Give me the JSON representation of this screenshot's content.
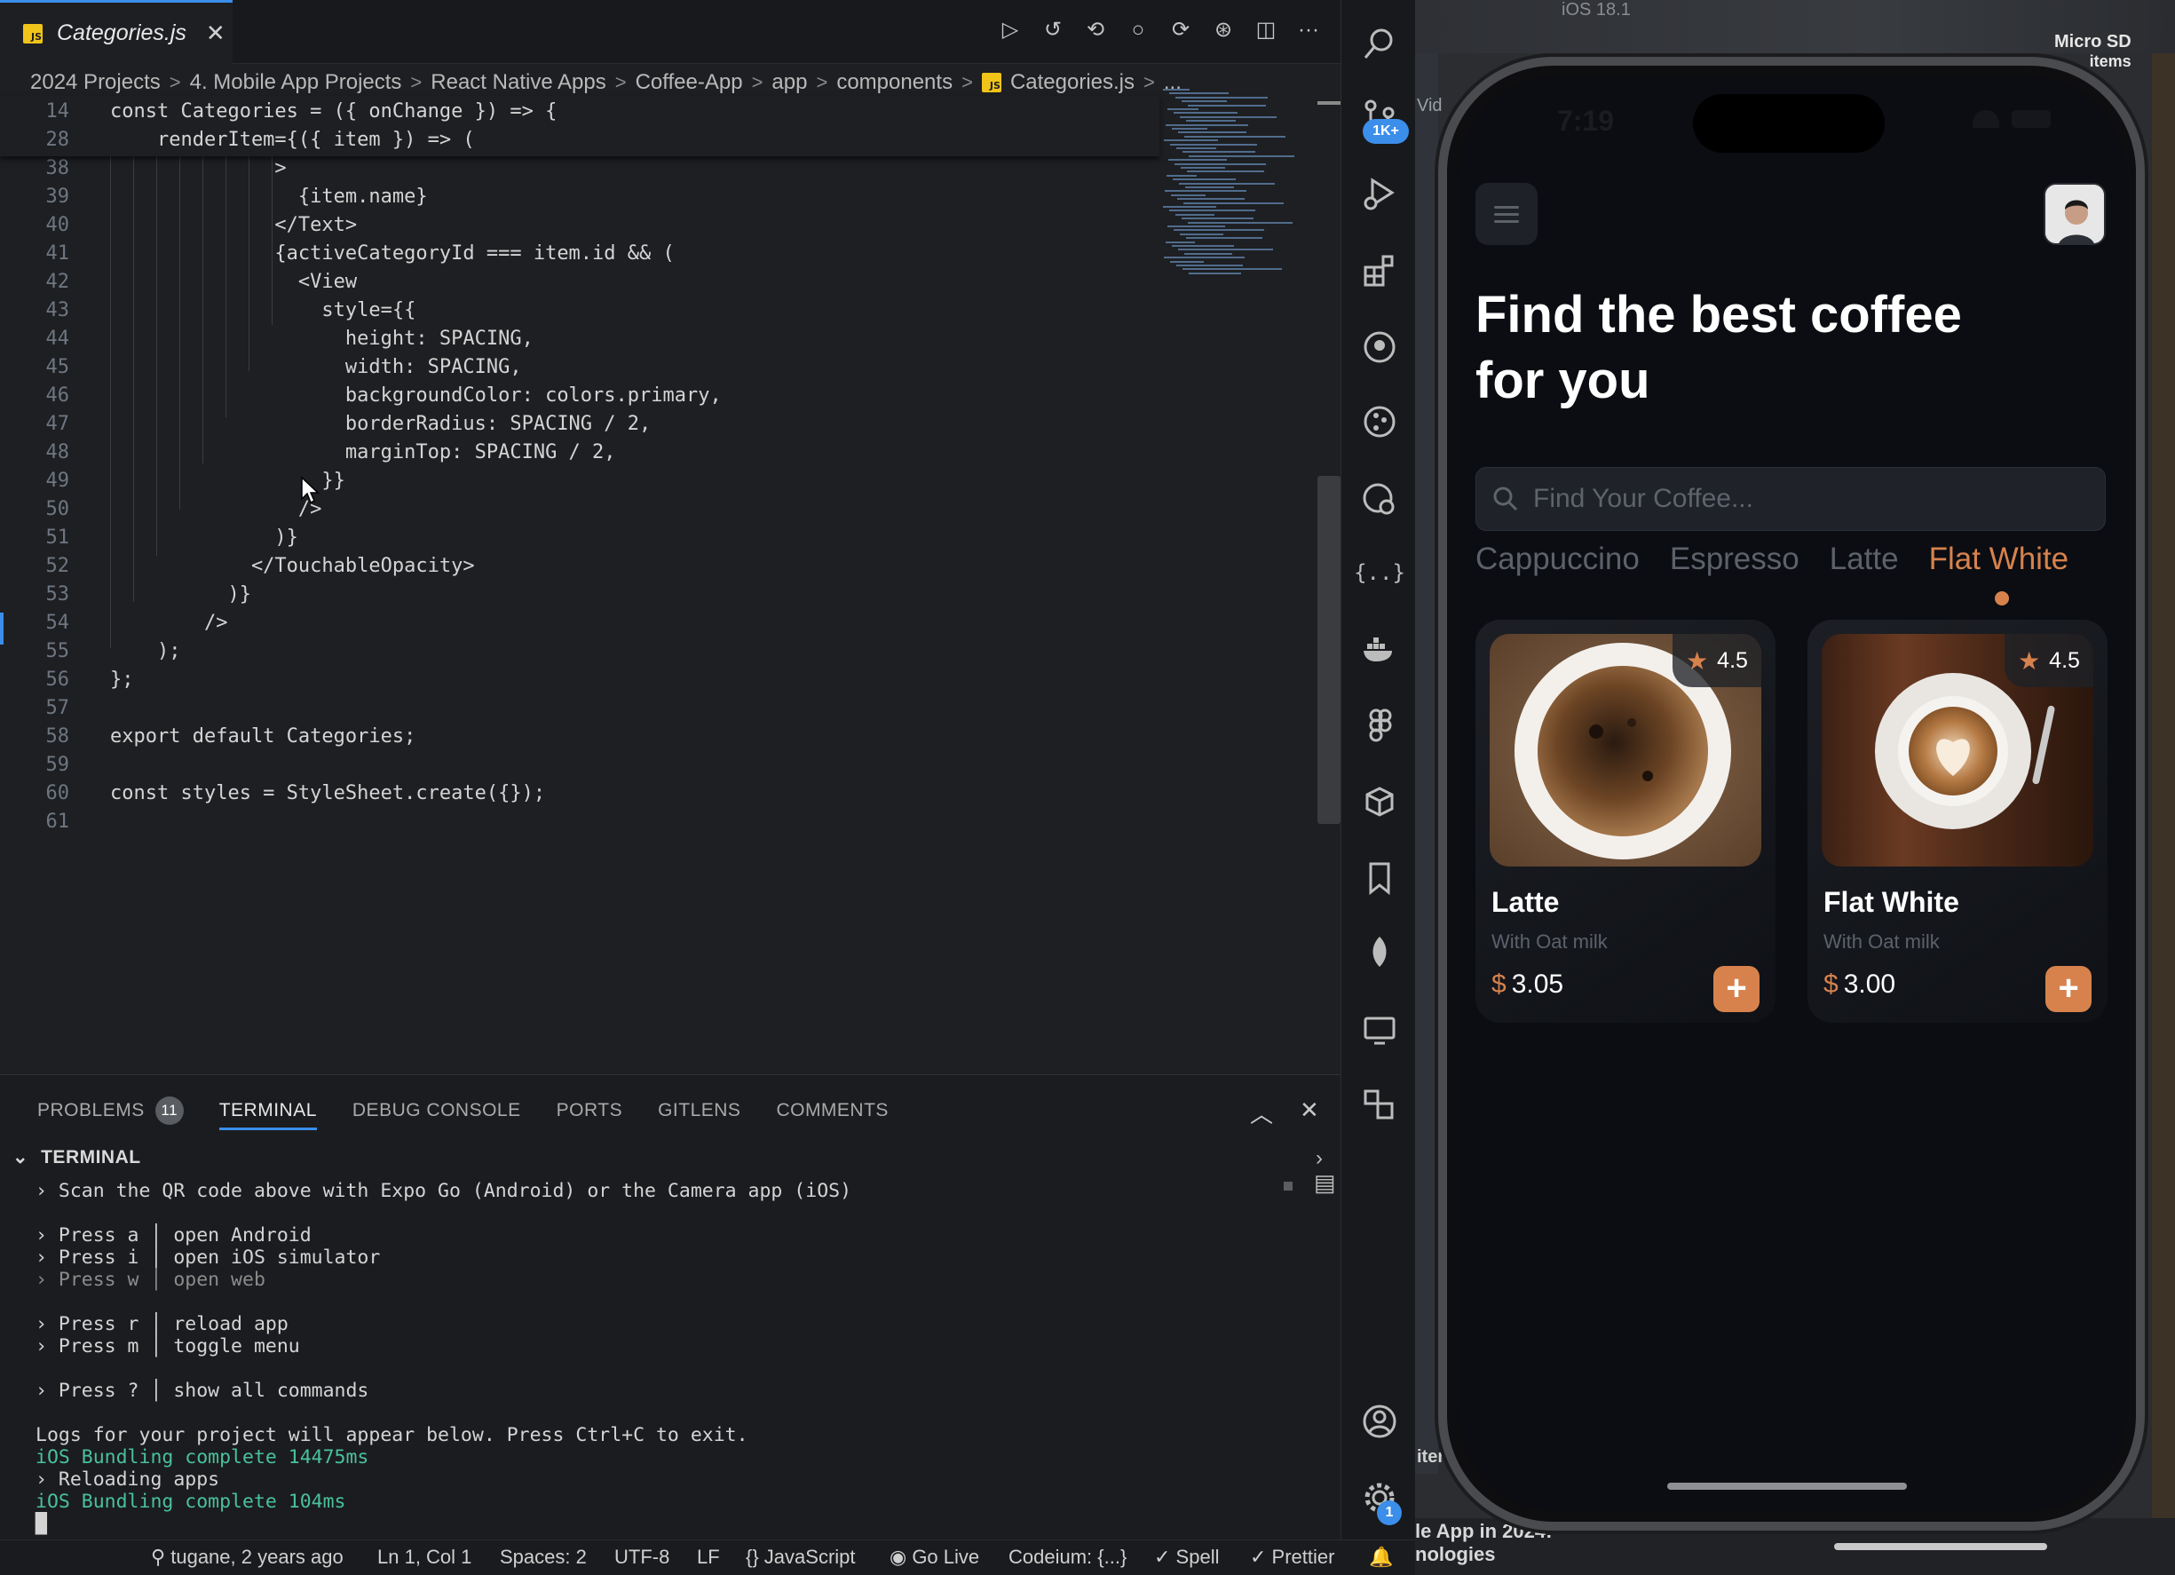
{
  "editor": {
    "tab": {
      "title": "Categories.js",
      "badge": "JS",
      "close": "✕"
    },
    "actions": [
      "▷",
      "↺",
      "⟲",
      "○",
      "⟳",
      "⊛",
      "◫",
      "···"
    ],
    "breadcrumb": [
      "2024 Projects",
      "4. Mobile App Projects",
      "React Native Apps",
      "Coffee-App",
      "app",
      "components",
      "Categories.js",
      "..."
    ],
    "breadcrumb_sep": ">",
    "sticky_lines": [
      {
        "n": "14",
        "text": "const Categories = ({ onChange }) => {"
      },
      {
        "n": "28",
        "text": "    renderItem={({ item }) => ("
      }
    ],
    "lines": [
      {
        "n": "38",
        "text": "              >"
      },
      {
        "n": "39",
        "text": "                {item.name}"
      },
      {
        "n": "40",
        "text": "              </Text>"
      },
      {
        "n": "41",
        "text": "              {activeCategoryId === item.id && ("
      },
      {
        "n": "42",
        "text": "                <View"
      },
      {
        "n": "43",
        "text": "                  style={{"
      },
      {
        "n": "44",
        "text": "                    height: SPACING,"
      },
      {
        "n": "45",
        "text": "                    width: SPACING,"
      },
      {
        "n": "46",
        "text": "                    backgroundColor: colors.primary,"
      },
      {
        "n": "47",
        "text": "                    borderRadius: SPACING / 2,"
      },
      {
        "n": "48",
        "text": "                    marginTop: SPACING / 2,"
      },
      {
        "n": "49",
        "text": "                  }}"
      },
      {
        "n": "50",
        "text": "                />"
      },
      {
        "n": "51",
        "text": "              )}"
      },
      {
        "n": "52",
        "text": "            </TouchableOpacity>"
      },
      {
        "n": "53",
        "text": "          )}"
      },
      {
        "n": "54",
        "text": "        />"
      },
      {
        "n": "55",
        "text": "    );"
      },
      {
        "n": "56",
        "text": "};"
      },
      {
        "n": "57",
        "text": ""
      },
      {
        "n": "58",
        "text": "export default Categories;"
      },
      {
        "n": "59",
        "text": ""
      },
      {
        "n": "60",
        "text": "const styles = StyleSheet.create({});"
      },
      {
        "n": "61",
        "text": ""
      }
    ]
  },
  "panel": {
    "tabs": [
      {
        "label": "PROBLEMS",
        "count": "11"
      },
      {
        "label": "TERMINAL"
      },
      {
        "label": "DEBUG CONSOLE"
      },
      {
        "label": "PORTS"
      },
      {
        "label": "GITLENS"
      },
      {
        "label": "COMMENTS"
      }
    ],
    "controls": [
      "︿",
      "✕"
    ],
    "terminal_title": "TERMINAL",
    "terminal_lines": [
      {
        "text": "› Scan the QR code above with Expo Go (Android) or the Camera app (iOS)",
        "cls": ""
      },
      {
        "text": "",
        "cls": ""
      },
      {
        "text": "› Press a │ open Android",
        "cls": ""
      },
      {
        "text": "› Press i │ open iOS simulator",
        "cls": ""
      },
      {
        "text": "› Press w │ open web",
        "cls": "dim"
      },
      {
        "text": "",
        "cls": ""
      },
      {
        "text": "› Press r │ reload app",
        "cls": ""
      },
      {
        "text": "› Press m │ toggle menu",
        "cls": ""
      },
      {
        "text": "",
        "cls": ""
      },
      {
        "text": "› Press ? │ show all commands",
        "cls": ""
      },
      {
        "text": "",
        "cls": ""
      },
      {
        "text": "Logs for your project will appear below. Press Ctrl+C to exit.",
        "cls": ""
      },
      {
        "text": "iOS Bundling complete 14475ms",
        "cls": "green"
      },
      {
        "text": "› Reloading apps",
        "cls": ""
      },
      {
        "text": "iOS Bundling complete 104ms",
        "cls": "green"
      },
      {
        "text": "█",
        "cls": ""
      }
    ]
  },
  "statusbar": [
    "tugane, 2 years ago",
    "Ln 1, Col 1",
    "Spaces: 2",
    "UTF-8",
    "LF",
    "{} JavaScript",
    "Go Live",
    "Codeium: {...}",
    "✓ Spell",
    "✓ Prettier"
  ],
  "activity": {
    "badges": {
      "scm": "1K+",
      "settings": "1"
    }
  },
  "desktop": {
    "ios_label": "iOS 18.1",
    "sd_label": "Micro SD",
    "sd_sub": "items",
    "bottom_text": "le App in 2024:",
    "bottom_text2": "nologies",
    "side_text": "Vid",
    "side_text2": "iter"
  },
  "app": {
    "status_time": "7:19",
    "heading_line1": "Find the best coffee",
    "heading_line2": "for you",
    "search_placeholder": "Find Your Coffee...",
    "categories": [
      "Cappuccino",
      "Espresso",
      "Latte",
      "Flat White"
    ],
    "active_category": "Flat White",
    "cards": [
      {
        "name": "Latte",
        "subtitle": "With Oat milk",
        "currency": "$",
        "price": "3.05",
        "rating": "4.5"
      },
      {
        "name": "Flat White",
        "subtitle": "With Oat milk",
        "currency": "$",
        "price": "3.00",
        "rating": "4.5"
      }
    ],
    "colors": {
      "primary": "#d7824d",
      "background": "#0b0d12"
    }
  }
}
